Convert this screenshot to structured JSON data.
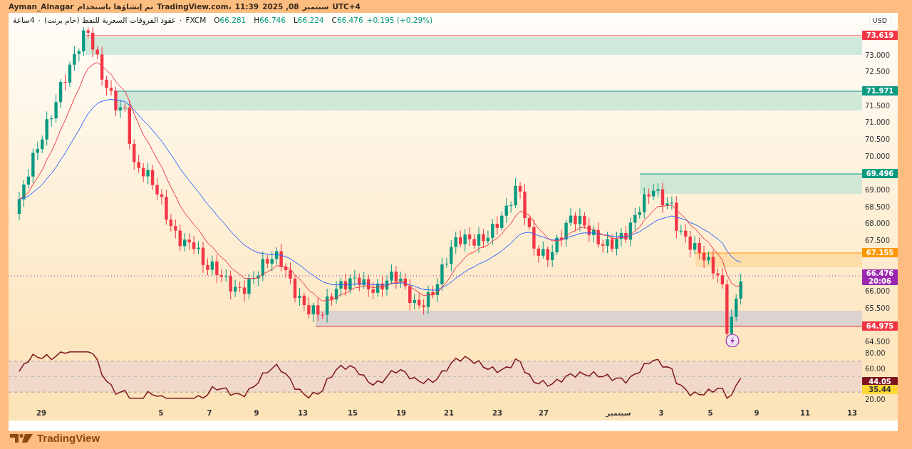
{
  "header": {
    "parts": [
      "Ayman_Alnagar",
      "تم إنشاؤها باستخدام",
      "TradingView.com،",
      "11:39",
      "2025 ,08",
      "سبتمبر",
      "UTC+4"
    ]
  },
  "legend": {
    "timeframe": "4ساعة",
    "separator": "·",
    "symbol": "عقود الفروقات السعرية للنفط (خام برنت)",
    "separator_2": "·",
    "exchange": "FXCM",
    "ohlc": [
      {
        "label": "O",
        "value": "66.281"
      },
      {
        "label": "H",
        "value": "66.746"
      },
      {
        "label": "L",
        "value": "66.224"
      },
      {
        "label": "C",
        "value": "66.476"
      }
    ],
    "change": "+0.195 (+0.29%)"
  },
  "price_axis": {
    "currency": "USD",
    "labels": [
      "73.000",
      "72.500",
      "71.500",
      "71.000",
      "70.500",
      "70.000",
      "69.000",
      "68.500",
      "68.000",
      "67.500",
      "66.000",
      "65.500",
      "64.500"
    ],
    "markers": [
      {
        "value": "73.619",
        "color": "#f23645"
      },
      {
        "value": "71.971",
        "color": "#089981"
      },
      {
        "value": "69.496",
        "color": "#089981"
      },
      {
        "value": "67.155",
        "color": "#ff9800"
      },
      {
        "value": "66.476",
        "countdown": "20:06",
        "color": "#9c27b0"
      },
      {
        "value": "64.975",
        "color": "#f23645"
      }
    ]
  },
  "rsi_axis": {
    "labels": [
      "80.00",
      "60.00",
      "20.00"
    ],
    "markers": [
      {
        "value": "44.05",
        "color": "#7f1421"
      },
      {
        "value": "35.44",
        "color": "#fdd835"
      }
    ]
  },
  "time_axis": {
    "labels": [
      "29",
      "5",
      "7",
      "9",
      "13",
      "15",
      "19",
      "21",
      "23",
      "27",
      "سبتمبر",
      "3",
      "5",
      "9",
      "11",
      "13"
    ]
  },
  "footer": {
    "brand": "TradingView"
  }
}
